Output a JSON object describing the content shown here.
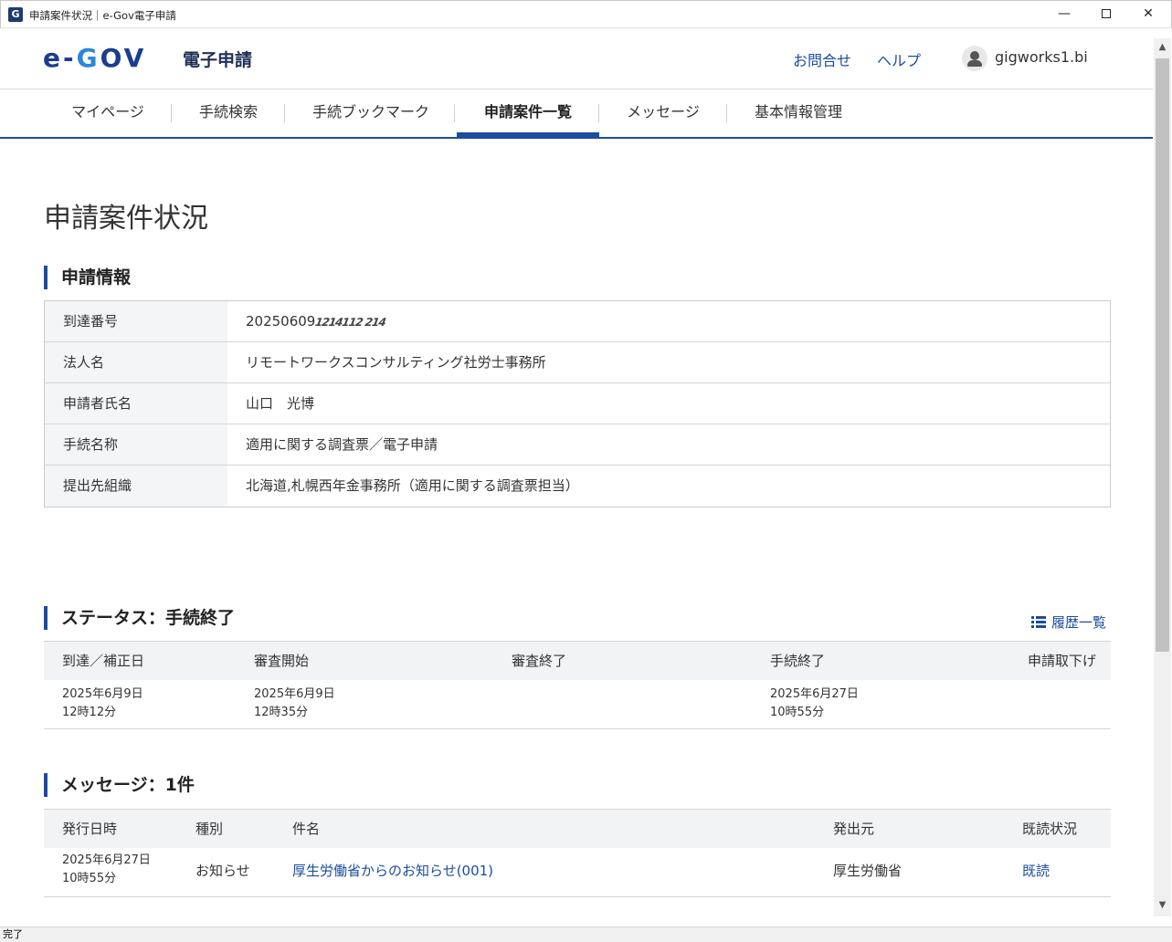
{
  "window": {
    "title": "申請案件状況｜e-Gov電子申請",
    "icon_letter": "G"
  },
  "header": {
    "logo_text_e": "e-",
    "logo_text_g": "G",
    "logo_text_ov": "OV",
    "logo_sub": "電子申請",
    "contact_label": "お問合せ",
    "help_label": "ヘルプ",
    "user_name": "gigworks1.bi"
  },
  "nav": {
    "items": [
      {
        "label": "マイページ"
      },
      {
        "label": "手続検索"
      },
      {
        "label": "手続ブックマーク"
      },
      {
        "label": "申請案件一覧"
      },
      {
        "label": "メッセージ"
      },
      {
        "label": "基本情報管理"
      }
    ],
    "active_index": 3
  },
  "page": {
    "title": "申請案件状況"
  },
  "application_info": {
    "section_title": "申請情報",
    "rows": [
      {
        "label": "到達番号",
        "value": "20250609",
        "masked_suffix": "1214112 214"
      },
      {
        "label": "法人名",
        "value": "リモートワークスコンサルティング社労士事務所"
      },
      {
        "label": "申請者氏名",
        "value": "山口　光博"
      },
      {
        "label": "手続名称",
        "value": "適用に関する調査票／電子申請"
      },
      {
        "label": "提出先組織",
        "value": "北海道,札幌西年金事務所（適用に関する調査票担当）"
      }
    ]
  },
  "status": {
    "section_title": "ステータス：手続終了",
    "history_link": "履歴一覧",
    "columns": [
      "到達／補正日",
      "審査開始",
      "審査終了",
      "手続終了",
      "申請取下げ"
    ],
    "values": [
      {
        "date": "2025年6月9日",
        "time": "12時12分"
      },
      {
        "date": "2025年6月9日",
        "time": "12時35分"
      },
      {
        "date": "",
        "time": ""
      },
      {
        "date": "2025年6月27日",
        "time": "10時55分"
      },
      {
        "date": "",
        "time": ""
      }
    ]
  },
  "messages": {
    "section_title": "メッセージ：1件",
    "columns": [
      "発行日時",
      "種別",
      "件名",
      "発出元",
      "既読状況"
    ],
    "rows": [
      {
        "date": "2025年6月27日",
        "time": "10時55分",
        "type": "お知らせ",
        "subject": "厚生労働省からのお知らせ(001)",
        "sender": "厚生労働省",
        "read_status": "既読"
      }
    ]
  },
  "statusbar": {
    "text": "完了"
  },
  "colors": {
    "brand_blue": "#1b4ca0",
    "logo_navy": "#1b3d8f",
    "logo_light_blue": "#2b87d8",
    "table_header_bg": "#f2f3f5"
  }
}
